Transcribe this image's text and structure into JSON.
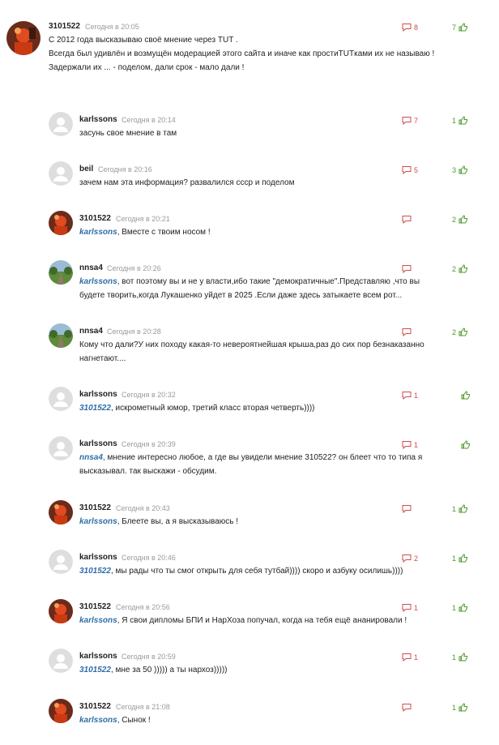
{
  "comments": [
    {
      "author": "3101522",
      "time": "Сегодня в 20:05",
      "dislikes": "8",
      "likes": "7",
      "lines": [
        "С 2012 года высказываю своё мнение через TUT .",
        "Всегда был удивлён и возмущён модерацией этого сайта и иначе как простиTUTками их не называю !",
        "Задержали их ... - поделом, дали срок - мало дали !"
      ]
    },
    {
      "author": "karlssons",
      "time": "Сегодня в 20:14",
      "dislikes": "7",
      "likes": "1",
      "reply_to": "",
      "lines": [
        "засунь свое мнение в там"
      ]
    },
    {
      "author": "beil",
      "time": "Сегодня в 20:16",
      "dislikes": "5",
      "likes": "3",
      "reply_to": "",
      "lines": [
        "зачем нам эта информация? развалился ссср и поделом"
      ]
    },
    {
      "author": "3101522",
      "time": "Сегодня в 20:21",
      "dislikes": "",
      "likes": "2",
      "reply_to": "karlssons",
      "lines": [
        ", Вместе с твоим носом !"
      ]
    },
    {
      "author": "nnsa4",
      "time": "Сегодня в 20:26",
      "dislikes": "",
      "likes": "2",
      "reply_to": "karlssons",
      "lines": [
        ", вот поэтому вы и не у власти,ибо такие \"демократичные\".Представляю ,что вы",
        "будете творить,когда Лукашенко уйдет в 2025 .Если даже здесь затыкаете всем рот..."
      ]
    },
    {
      "author": "nnsa4",
      "time": "Сегодня в 20:28",
      "dislikes": "",
      "likes": "2",
      "reply_to": "",
      "lines": [
        "Кому что дали?У них походу какая-то невероятнейшая крыша,раз до сих пор безнаказанно",
        "нагнетают...."
      ]
    },
    {
      "author": "karlssons",
      "time": "Сегодня в 20:32",
      "dislikes": "1",
      "likes": "",
      "reply_to": "3101522",
      "lines": [
        ", искрометный юмор, третий класс вторая четверть))))"
      ]
    },
    {
      "author": "karlssons",
      "time": "Сегодня в 20:39",
      "dislikes": "1",
      "likes": "",
      "reply_to": "nnsa4",
      "lines": [
        ", мнение интересно любое, а где вы увидели мнение 310522? он блеет что то типа я",
        "высказывал. так выскажи - обсудим."
      ]
    },
    {
      "author": "3101522",
      "time": "Сегодня в 20:43",
      "dislikes": "",
      "likes": "1",
      "reply_to": "karlssons",
      "lines": [
        ", Блеете вы, а я высказываюсь !"
      ]
    },
    {
      "author": "karlssons",
      "time": "Сегодня в 20:46",
      "dislikes": "2",
      "likes": "1",
      "reply_to": "3101522",
      "lines": [
        ", мы рады что ты смог открыть для себя тутбай)))) скоро и азбуку осилишь))))"
      ]
    },
    {
      "author": "3101522",
      "time": "Сегодня в 20:56",
      "dislikes": "1",
      "likes": "1",
      "reply_to": "karlssons",
      "lines": [
        ", Я свои дипломы БПИ и НарХоза попучал, когда на тебя ещё ананировали !"
      ]
    },
    {
      "author": "karlssons",
      "time": "Сегодня в 20:59",
      "dislikes": "1",
      "likes": "1",
      "reply_to": "3101522",
      "lines": [
        ", мне за 50 ))))) а ты нархоз)))))"
      ]
    },
    {
      "author": "3101522",
      "time": "Сегодня в 21:08",
      "dislikes": "",
      "likes": "1",
      "reply_to": "karlssons",
      "lines": [
        ", Сынок !"
      ]
    }
  ],
  "colors": {
    "dislike": "#d14b4b",
    "like": "#4c9a2a",
    "reply": "#2f6ea6",
    "time": "#9a9a9a"
  },
  "icons": {
    "dislike": "chat-bubble-icon",
    "like": "thumb-up-icon",
    "avatar_default": "user-silhouette-icon"
  }
}
